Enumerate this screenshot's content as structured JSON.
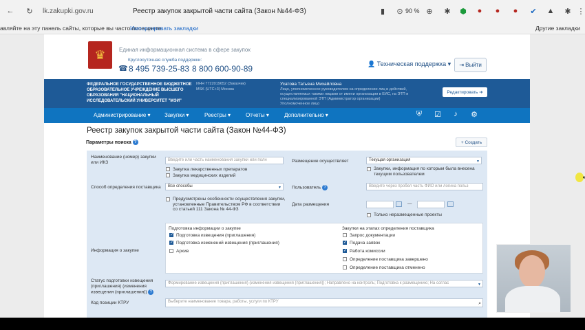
{
  "browser": {
    "url": "lk.zakupki.gov.ru",
    "tab_title": "Реестр закупок закрытой части сайта (Закон №44-ФЗ)",
    "zoom": "90 %",
    "bookmarks_hint": "авляйте на эту панель сайты, которые вы часто посещаете.",
    "import_bookmarks": "Импортировать закладки",
    "other_bookmarks": "Другие закладки"
  },
  "header": {
    "system_title": "Единая информационная система в сфере закупок",
    "support_label": "Круглосуточная служба поддержки:",
    "phone1": "8 495 739-25-83",
    "phone2": "8 800 600-90-89",
    "tech_support": "Техническая поддержка",
    "exit": "Выйти"
  },
  "org": {
    "name": "ФЕДЕРАЛЬНОЕ ГОСУДАРСТВЕННОЕ БЮДЖЕТНОЕ ОБРАЗОВАТЕЛЬНОЕ УЧРЕЖДЕНИЕ ВЫСШЕГО ОБРАЗОВАНИЯ \"НАЦИОНАЛЬНЫЙ ИССЛЕДОВАТЕЛЬСКИЙ УНИВЕРСИТЕТ \"МЭИ\"",
    "inn": "ИНН 7722019652 (Заказчик)",
    "tz": "MSK (UTC+3) Москва",
    "user_name": "Усатова Татьяна Михайловна",
    "user_role": "Лицо, уполномоченное руководителем на определение лиц и действий, осуществляемых такими лицами от имени организации в ЕИС, на ЭТП и специализированной ЭТП (Администратор организации)",
    "user_extra": "Уполномоченное лицо",
    "edit": "Редактировать"
  },
  "menu": {
    "items": [
      "Администрирование",
      "Закупки",
      "Реестры",
      "Отчеты",
      "Дополнительно"
    ]
  },
  "page": {
    "title": "Реестр закупок закрытой части сайта (Закон №44-ФЗ)",
    "params": "Параметры поиска",
    "create": "Создать"
  },
  "form": {
    "name_label": "Наименование (номер) закупки или ИКЗ",
    "name_placeholder": "Введите или часть наименования закупки или полн",
    "cb_drugs": "Закупка лекарственных препаратов",
    "cb_medical": "Закупка медицинских изделий",
    "placement_label": "Размещение осуществляет",
    "placement_value": "Текущая организация",
    "cb_current_user": "Закупки, информация по которым была внесена текущим пользователем",
    "method_label": "Способ определения поставщика",
    "method_value": "Все способы",
    "user_label": "Пользователь",
    "user_placeholder": "Введите через пробел часть ФИО или логина польз",
    "cb_gov": "Предусмотрены особенности осуществления закупки, установленные Правительством РФ в соответствии со статьей 111 Закона № 44-ФЗ",
    "date_label": "Дата размещения",
    "date_sep": "—",
    "cb_unplaced": "Только неразмещенные проекты",
    "info_label": "Информация о закупке",
    "prep_header": "Подготовка информации о закупке",
    "prep_items": [
      "Подготовка извещения (приглашения)",
      "Подготовка изменений извещения (приглашения)",
      "Архив"
    ],
    "stage_header": "Закупки на этапах определения поставщика",
    "stage_items": [
      "Запрос документации",
      "Подача заявок",
      "Работа комиссии",
      "Определение поставщика завершено",
      "Определение поставщика отменено"
    ],
    "status_label": "Статус подготовки извещения (приглашения) (изменения извещения (приглашения))",
    "status_value": "Формирование извещения (приглашения) (изменения извещения (приглашения)); Направлено на контроль; Подготовка к размещению; На соглас",
    "ktru_label": "Код позиции КТРУ",
    "ktru_placeholder": "Выберите наименование товара, работы, услуги по КТРУ"
  }
}
